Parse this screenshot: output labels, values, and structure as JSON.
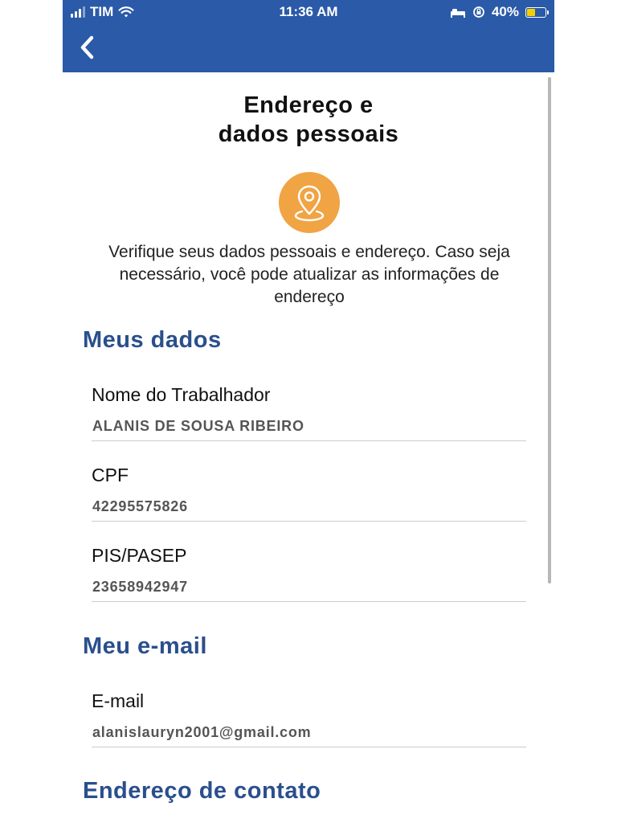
{
  "status_bar": {
    "carrier": "TIM",
    "time": "11:36 AM",
    "battery": "40%"
  },
  "header": {
    "back_icon": "chevron-left-icon"
  },
  "page": {
    "title_line1": "Endereço e",
    "title_line2": "dados pessoais",
    "icon": "location-pin-icon",
    "icon_color": "#f0a444",
    "intro": "Verifique seus dados pessoais e endereço. Caso seja necessário, você pode atualizar as informações de endereço"
  },
  "meus_dados": {
    "title": "Meus dados",
    "fields": [
      {
        "label": "Nome do Trabalhador",
        "value": "ALANIS DE SOUSA RIBEIRO"
      },
      {
        "label": "CPF",
        "value": "42295575826"
      },
      {
        "label": "PIS/PASEP",
        "value": "23658942947"
      }
    ]
  },
  "meu_email": {
    "title": "Meu e-mail",
    "fields": [
      {
        "label": "E-mail",
        "value": "alanislauryn2001@gmail.com"
      }
    ]
  },
  "endereco": {
    "title": "Endereço de contato"
  },
  "colors": {
    "header_bg": "#2a5aa8",
    "section_title": "#2a4f8c"
  }
}
